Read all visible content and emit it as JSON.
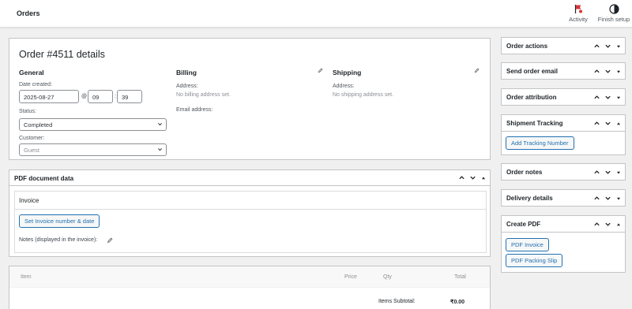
{
  "topbar": {
    "title": "Orders",
    "activity_label": "Activity",
    "finish_setup_label": "Finish setup"
  },
  "order": {
    "title": "Order #4511 details",
    "general": {
      "heading": "General",
      "date_label": "Date created:",
      "date_value": "2025-08-27",
      "at": "@",
      "hour": "09",
      "colon": ":",
      "minute": "39",
      "status_label": "Status:",
      "status_value": "Completed",
      "customer_label": "Customer:",
      "customer_value": "Guest"
    },
    "billing": {
      "heading": "Billing",
      "address_label": "Address:",
      "address_value": "No billing address set.",
      "email_label": "Email address:"
    },
    "shipping": {
      "heading": "Shipping",
      "address_label": "Address:",
      "address_value": "No shipping address set."
    }
  },
  "pdf": {
    "heading": "PDF document data",
    "invoice_heading": "Invoice",
    "set_button": "Set Invoice number & date",
    "notes_label": "Notes (displayed in the invoice):"
  },
  "items": {
    "col_item": "Item",
    "col_price": "Price",
    "col_qty": "Qty",
    "col_total": "Total",
    "subtotal_label": "Items Subtotal:",
    "subtotal_value": "₹0.00"
  },
  "sidebar": {
    "order_actions": "Order actions",
    "send_email": "Send order email",
    "attribution": "Order attribution",
    "shipment": "Shipment Tracking",
    "add_tracking": "Add Tracking Number",
    "order_notes": "Order notes",
    "delivery": "Delivery details",
    "create_pdf": "Create PDF",
    "pdf_invoice": "PDF Invoice",
    "pdf_packing": "PDF Packing Slip"
  },
  "colors": {
    "accent": "#2271b1",
    "flag": "#d63638"
  }
}
